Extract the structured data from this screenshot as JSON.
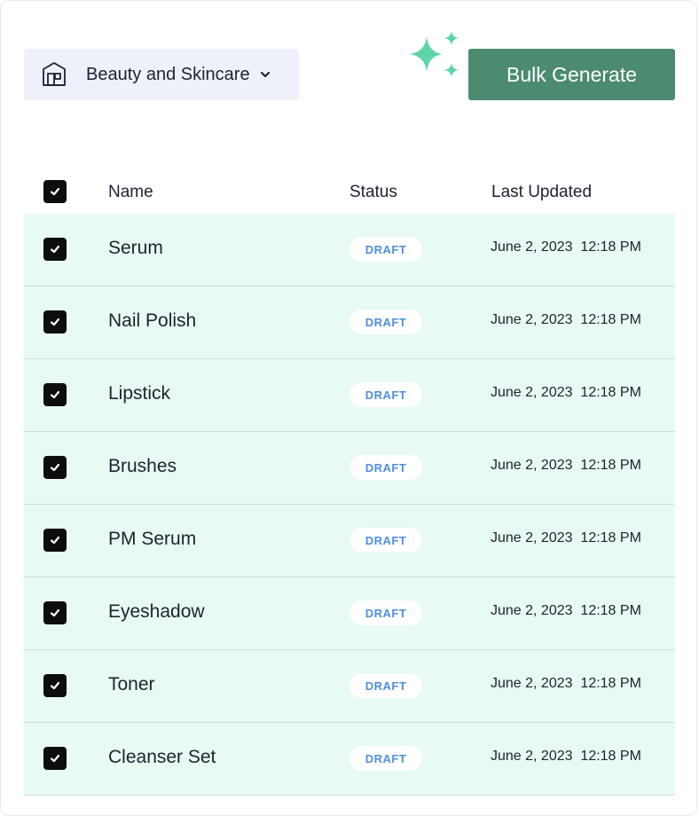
{
  "category_select": {
    "label": "Beauty and Skincare",
    "icon": "store-icon"
  },
  "toolbar": {
    "bulk_generate_label": "Bulk Generate",
    "sparkle_icon": "sparkle-icon"
  },
  "colors": {
    "primary_button": "#4b8b6f",
    "sparkle": "#5fd4a8",
    "row_background": "#e7fbf3",
    "draft_text": "#4d8fdc"
  },
  "table": {
    "headers": {
      "name": "Name",
      "status": "Status",
      "last_updated": "Last Updated"
    },
    "select_all_checked": true,
    "rows": [
      {
        "name": "Serum",
        "status": "DRAFT",
        "updated": "June 2, 2023  12:18 PM",
        "checked": true
      },
      {
        "name": "Nail Polish",
        "status": "DRAFT",
        "updated": "June 2, 2023  12:18 PM",
        "checked": true
      },
      {
        "name": "Lipstick",
        "status": "DRAFT",
        "updated": "June 2, 2023  12:18 PM",
        "checked": true
      },
      {
        "name": "Brushes",
        "status": "DRAFT",
        "updated": "June 2, 2023  12:18 PM",
        "checked": true
      },
      {
        "name": "PM Serum",
        "status": "DRAFT",
        "updated": "June 2, 2023  12:18 PM",
        "checked": true
      },
      {
        "name": "Eyeshadow",
        "status": "DRAFT",
        "updated": "June 2, 2023  12:18 PM",
        "checked": true
      },
      {
        "name": "Toner",
        "status": "DRAFT",
        "updated": "June 2, 2023  12:18 PM",
        "checked": true
      },
      {
        "name": "Cleanser Set",
        "status": "DRAFT",
        "updated": "June 2, 2023  12:18 PM",
        "checked": true
      }
    ]
  }
}
